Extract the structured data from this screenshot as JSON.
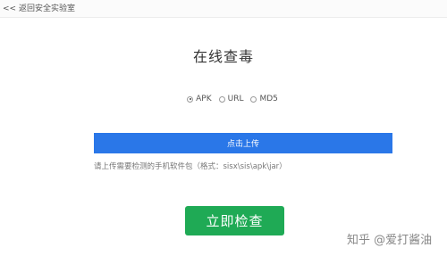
{
  "header": {
    "back_link": "<< 返回安全实验室"
  },
  "main": {
    "title": "在线查毒",
    "file_types": [
      {
        "label": "APK",
        "checked": true
      },
      {
        "label": "URL",
        "checked": false
      },
      {
        "label": "MD5",
        "checked": false
      }
    ],
    "upload_label": "点击上传",
    "hint": "请上传需要检测的手机软件包（格式：sisx\\sis\\apk\\jar）",
    "check_label": "立即检查"
  },
  "watermark": "知乎 @爱打酱油",
  "colors": {
    "upload_button": "#2a77e8",
    "check_button": "#1faa55"
  }
}
